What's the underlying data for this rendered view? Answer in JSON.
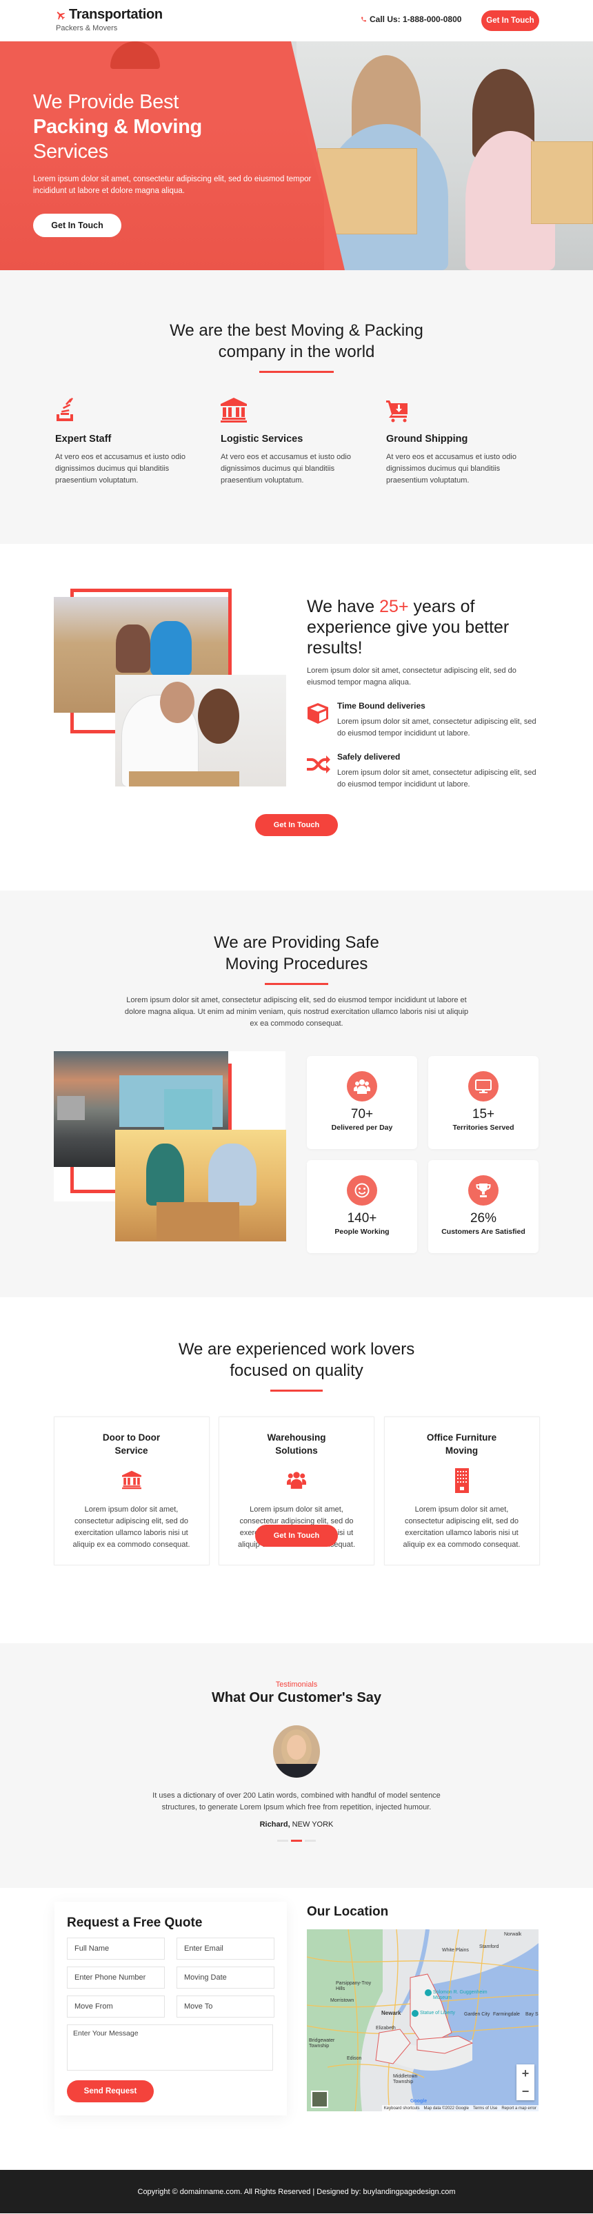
{
  "header": {
    "logo_title": "Transportation",
    "logo_subtitle": "Packers & Movers",
    "call_text": "Call Us: 1-888-000-0800",
    "cta_label": "Get In Touch",
    "accent_color": "#f4433c"
  },
  "hero": {
    "line1": "We Provide Best",
    "line2": "Packing & Moving",
    "line3": "Services",
    "paragraph": "Lorem ipsum dolor sit amet, consectetur adipiscing elit, sed do eiusmod tempor incididunt ut labore et dolore magna aliqua.",
    "button_label": "Get In Touch"
  },
  "best": {
    "heading_line1": "We are the best Moving & Packing",
    "heading_line2": "company in the world",
    "features": [
      {
        "icon": "stack-icon",
        "title": "Expert Staff",
        "text": "At vero eos et accusamus et iusto odio dignissimos ducimus qui blanditiis praesentium voluptatum."
      },
      {
        "icon": "bank-icon",
        "title": "Logistic Services",
        "text": "At vero eos et accusamus et iusto odio dignissimos ducimus qui blanditiis praesentium voluptatum."
      },
      {
        "icon": "cart-download-icon",
        "title": "Ground Shipping",
        "text": "At vero eos et accusamus et iusto odio dignissimos ducimus qui blanditiis praesentium voluptatum."
      }
    ]
  },
  "experience": {
    "heading_pre": "We have ",
    "heading_accent": "25+",
    "heading_post": " years of experience give you better results!",
    "paragraph": "Lorem ipsum dolor sit amet, consectetur adipiscing elit, sed do eiusmod tempor magna aliqua.",
    "items": [
      {
        "icon": "cube-icon",
        "title": "Time Bound deliveries",
        "text": "Lorem ipsum dolor sit amet, consectetur adipiscing elit, sed do eiusmod tempor incididunt ut labore."
      },
      {
        "icon": "shuffle-icon",
        "title": "Safely delivered",
        "text": "Lorem ipsum dolor sit amet, consectetur adipiscing elit, sed do eiusmod tempor incididunt ut labore."
      }
    ],
    "button_label": "Get In Touch"
  },
  "procedures": {
    "heading_line1": "We are Providing Safe",
    "heading_line2": "Moving Procedures",
    "paragraph": "Lorem ipsum dolor sit amet, consectetur adipiscing elit, sed do eiusmod tempor incididunt ut labore et dolore magna aliqua. Ut enim ad minim veniam, quis nostrud exercitation ullamco laboris nisi ut aliquip ex ea commodo consequat.",
    "stats": [
      {
        "icon": "users-icon",
        "value": "70+",
        "label": "Delivered per Day"
      },
      {
        "icon": "monitor-icon",
        "value": "15+",
        "label": "Territories Served"
      },
      {
        "icon": "smile-icon",
        "value": "140+",
        "label": "People Working"
      },
      {
        "icon": "trophy-icon",
        "value": "26%",
        "label": "Customers Are Satisfied"
      }
    ]
  },
  "quality": {
    "heading_line1": "We are experienced work lovers",
    "heading_line2": "focused on quality",
    "cards": [
      {
        "icon": "bank-icon",
        "title": "Door to Door Service",
        "text": "Lorem ipsum dolor sit amet, consectetur adipiscing elit, sed do exercitation ullamco laboris nisi ut aliquip ex ea commodo consequat."
      },
      {
        "icon": "users-icon",
        "title": "Warehousing Solutions",
        "text": "Lorem ipsum dolor sit amet, consectetur adipiscing elit, sed do exercitation ullamco laboris nisi ut aliquip ex ea commodo consequat."
      },
      {
        "icon": "building-icon",
        "title": "Office Furniture Moving",
        "text": "Lorem ipsum dolor sit amet, consectetur adipiscing elit, sed do exercitation ullamco laboris nisi ut aliquip ex ea commodo consequat."
      }
    ],
    "button_label": "Get In Touch"
  },
  "testimonials": {
    "label": "Testimonials",
    "title": "What Our Customer's Say",
    "quote": "It uses a dictionary of over 200 Latin words, combined with handful of model sentence structures, to generate Lorem Ipsum which free from repetition, injected humour.",
    "author_name": "Richard,",
    "author_location": " NEW YORK",
    "slides": 3,
    "active_slide": 2
  },
  "contact": {
    "form_title": "Request a Free Quote",
    "fields": {
      "full_name": "Full Name",
      "email": "Enter Email",
      "phone": "Enter Phone Number",
      "moving_date": "Moving Date",
      "move_from": "Move From",
      "move_to": "Move To",
      "message": "Enter Your Message"
    },
    "submit_label": "Send Request",
    "location_title": "Our Location",
    "map": {
      "labels": [
        "White Plains",
        "Stamford",
        "Norwalk",
        "Parsippany-Troy Hills",
        "Morristown",
        "Newark",
        "Elizabeth",
        "Bridgewater Township",
        "Edison",
        "Middletown Township",
        "Garden City",
        "Farmingdale",
        "Bay S"
      ],
      "pois": [
        "Solomon R. Guggenheim Museum",
        "Statue of Liberty"
      ],
      "attribution": [
        "Keyboard shortcuts",
        "Map data ©2022 Google",
        "Terms of Use",
        "Report a map error"
      ],
      "zoom_in": "+",
      "zoom_out": "−",
      "brand": "Google"
    }
  },
  "footer": {
    "text": "Copyright © domainname.com. All Rights Reserved | Designed by: buylandingpagedesign.com"
  }
}
